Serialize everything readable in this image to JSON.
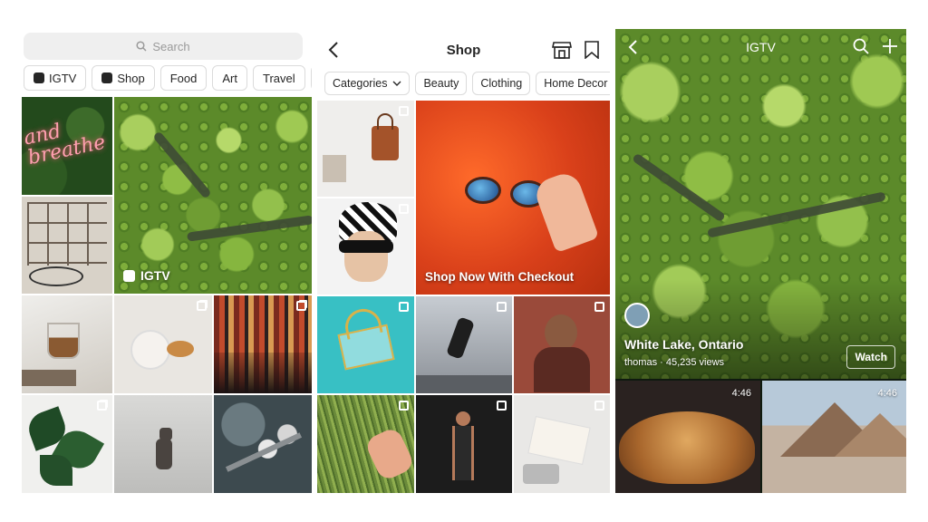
{
  "explore": {
    "search_placeholder": "Search",
    "chips": [
      {
        "label": "IGTV",
        "icon": "igtv-icon"
      },
      {
        "label": "Shop",
        "icon": "shopping-bag-icon"
      },
      {
        "label": "Food"
      },
      {
        "label": "Art"
      },
      {
        "label": "Travel"
      },
      {
        "label": "Ar"
      }
    ],
    "neon_text": "and breathe",
    "featured_label": "IGTV"
  },
  "shop": {
    "title": "Shop",
    "categories": [
      "Categories",
      "Beauty",
      "Clothing",
      "Home Decor"
    ],
    "featured_caption": "Shop Now With Checkout"
  },
  "igtv": {
    "title": "IGTV",
    "video_title": "White Lake, Ontario",
    "video_meta": "thomas · 45,235 views",
    "watch_label": "Watch",
    "thumbs": [
      {
        "duration": "4:46"
      },
      {
        "duration": "4:46"
      }
    ]
  },
  "colors": {
    "accent_orange": "#e2481c",
    "forest_green": "#6f9d33",
    "teal": "#38c0c4"
  }
}
